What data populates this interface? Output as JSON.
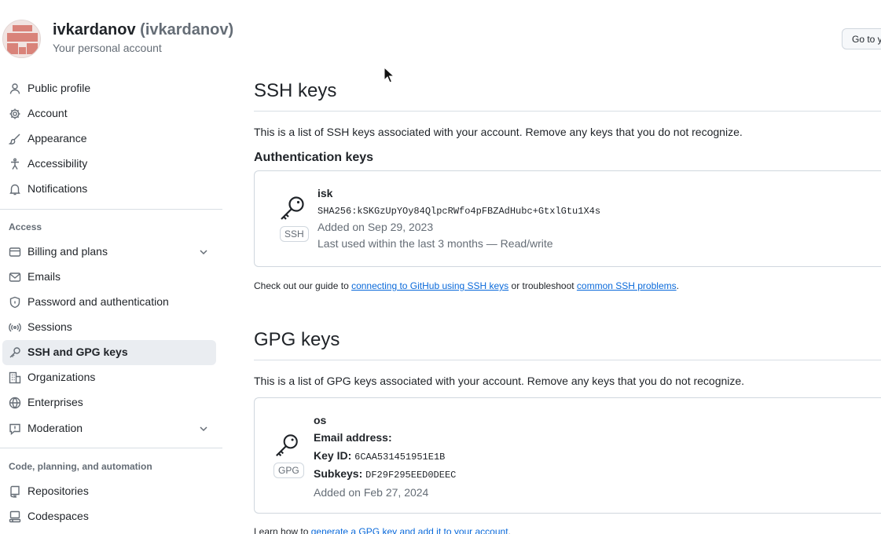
{
  "header": {
    "user_name": "ivkardanov",
    "user_handle": "(ivkardanov)",
    "subtitle": "Your personal account",
    "goto_button": "Go to your personal profile"
  },
  "sidebar": {
    "items": [
      {
        "label": "Public profile",
        "icon": "person-icon"
      },
      {
        "label": "Account",
        "icon": "gear-icon"
      },
      {
        "label": "Appearance",
        "icon": "paintbrush-icon"
      },
      {
        "label": "Accessibility",
        "icon": "accessibility-icon"
      },
      {
        "label": "Notifications",
        "icon": "bell-icon"
      }
    ],
    "access_heading": "Access",
    "access_items": [
      {
        "label": "Billing and plans",
        "icon": "credit-card-icon",
        "expandable": true
      },
      {
        "label": "Emails",
        "icon": "mail-icon"
      },
      {
        "label": "Password and authentication",
        "icon": "shield-lock-icon"
      },
      {
        "label": "Sessions",
        "icon": "broadcast-icon"
      },
      {
        "label": "SSH and GPG keys",
        "icon": "key-icon",
        "active": true
      },
      {
        "label": "Organizations",
        "icon": "organization-icon"
      },
      {
        "label": "Enterprises",
        "icon": "globe-icon"
      },
      {
        "label": "Moderation",
        "icon": "report-icon",
        "expandable": true
      }
    ],
    "code_heading": "Code, planning, and automation",
    "code_items": [
      {
        "label": "Repositories",
        "icon": "repo-icon"
      },
      {
        "label": "Codespaces",
        "icon": "codespaces-icon"
      }
    ]
  },
  "ssh": {
    "title": "SSH keys",
    "description": "This is a list of SSH keys associated with your account. Remove any keys that you do not recognize.",
    "auth_heading": "Authentication keys",
    "key": {
      "badge": "SSH",
      "name": "isk",
      "fingerprint": "SHA256:kSKGzUpYOy84QlpcRWfo4pFBZAdHubc+GtxlGtu1X4s",
      "added": "Added on Sep 29, 2023",
      "last_used": "Last used within the last 3 months — Read/write"
    },
    "guide_prefix": "Check out our guide to ",
    "guide_link": "connecting to GitHub using SSH keys",
    "guide_middle": " or troubleshoot ",
    "troubleshoot_link": "common SSH problems",
    "guide_suffix": "."
  },
  "gpg": {
    "title": "GPG keys",
    "description": "This is a list of GPG keys associated with your account. Remove any keys that you do not recognize.",
    "key": {
      "badge": "GPG",
      "name": "os",
      "email_label": "Email address:",
      "key_id_label": "Key ID:",
      "key_id": "6CAA531451951E1B",
      "subkeys_label": "Subkeys:",
      "subkeys": "DF29F295EED0DEEC",
      "added": "Added on Feb 27, 2024"
    },
    "learn_prefix": "Learn how to ",
    "learn_link": "generate a GPG key and add it to your account",
    "learn_suffix": "."
  },
  "colors": {
    "link": "#0969da",
    "active_bg": "#eaedf1",
    "muted": "#656d76"
  }
}
